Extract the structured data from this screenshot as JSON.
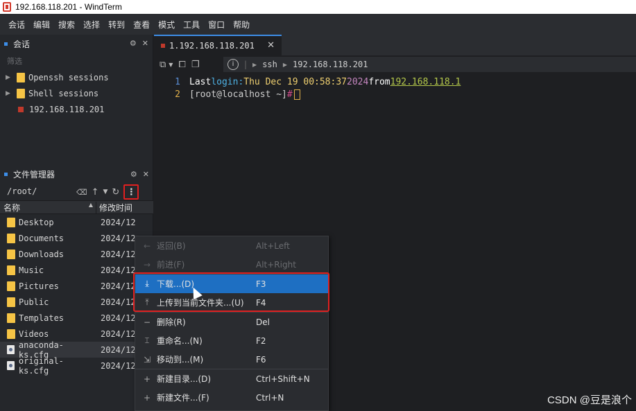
{
  "window": {
    "title": "192.168.118.201 - WindTerm"
  },
  "menubar": [
    "会话",
    "编辑",
    "搜索",
    "选择",
    "转到",
    "查看",
    "模式",
    "工具",
    "窗口",
    "帮助"
  ],
  "sessions_panel": {
    "title": "会话",
    "filter_placeholder": "筛选",
    "items": [
      {
        "label": "Openssh sessions",
        "type": "folder"
      },
      {
        "label": "Shell sessions",
        "type": "folder"
      },
      {
        "label": "192.168.118.201",
        "type": "session"
      }
    ]
  },
  "file_manager": {
    "title": "文件管理器",
    "path": "/root/",
    "columns": {
      "name": "名称",
      "modified": "修改时间"
    },
    "rows": [
      {
        "name": "Desktop",
        "type": "folder",
        "modified": "2024/12"
      },
      {
        "name": "Documents",
        "type": "folder",
        "modified": "2024/12"
      },
      {
        "name": "Downloads",
        "type": "folder",
        "modified": "2024/12"
      },
      {
        "name": "Music",
        "type": "folder",
        "modified": "2024/12"
      },
      {
        "name": "Pictures",
        "type": "folder",
        "modified": "2024/12"
      },
      {
        "name": "Public",
        "type": "folder",
        "modified": "2024/12"
      },
      {
        "name": "Templates",
        "type": "folder",
        "modified": "2024/12"
      },
      {
        "name": "Videos",
        "type": "folder",
        "modified": "2024/12"
      },
      {
        "name": "anaconda-ks.cfg",
        "type": "file",
        "modified": "2024/12"
      },
      {
        "name": "original-ks.cfg",
        "type": "file",
        "modified": "2024/12"
      }
    ]
  },
  "tab": {
    "label": "1.192.168.118.201"
  },
  "breadcrumb": {
    "protocol": "ssh",
    "host": "192.168.118.201"
  },
  "terminal": {
    "line1": {
      "num": "1",
      "last": "Last",
      "login": "login:",
      "date": "Thu Dec 19 00:58:37",
      "year": "2024",
      "from": "from",
      "ip": "192.168.118.1"
    },
    "line2": {
      "num": "2",
      "prompt": "[root@localhost ~]",
      "hash": "#"
    }
  },
  "context_menu": {
    "items": [
      {
        "label": "返回(B)",
        "shortcut": "Alt+Left",
        "icon": "arrow-left-icon",
        "disabled": true
      },
      {
        "label": "前进(F)",
        "shortcut": "Alt+Right",
        "icon": "arrow-right-icon",
        "disabled": true
      },
      {
        "label": "下载...(D)",
        "shortcut": "F3",
        "icon": "download-icon",
        "hover": true
      },
      {
        "label": "上传到当前文件夹...(U)",
        "shortcut": "F4",
        "icon": "upload-icon"
      },
      {
        "label": "删除(R)",
        "shortcut": "Del",
        "icon": "minus-icon"
      },
      {
        "label": "重命名...(N)",
        "shortcut": "F2",
        "icon": "rename-icon"
      },
      {
        "label": "移动到...(M)",
        "shortcut": "F6",
        "icon": "move-icon"
      },
      {
        "label": "新建目录...(D)",
        "shortcut": "Ctrl+Shift+N",
        "icon": "plus-icon"
      },
      {
        "label": "新建文件...(F)",
        "shortcut": "Ctrl+N",
        "icon": "plus-icon"
      }
    ]
  },
  "watermark": "CSDN @豆是浪个",
  "colors": {
    "accent": "#3d8ee8",
    "highlight": "#1e6fc2",
    "annotation_red": "#e02020",
    "session_red": "#c0392b"
  }
}
